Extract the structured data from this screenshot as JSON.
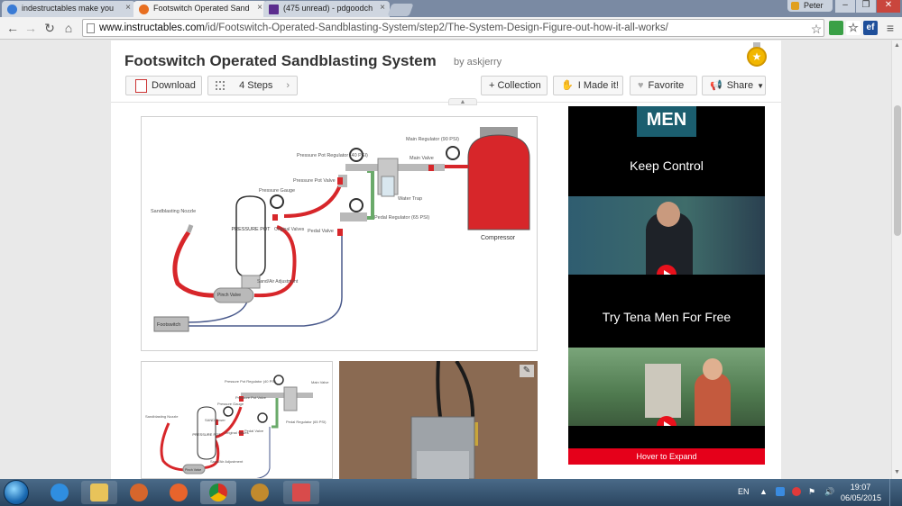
{
  "browser": {
    "tabs": [
      {
        "label": "indestructables make you",
        "icon_color": "#3a7bd5"
      },
      {
        "label": "Footswitch Operated Sand",
        "icon_color": "#e86f21"
      },
      {
        "label": "(475 unread) - pdgoodch",
        "icon_color": "#5b2d8e"
      }
    ],
    "user": "Peter",
    "window_controls": {
      "minimize": "–",
      "restore": "❐",
      "close": "✕"
    },
    "url": {
      "domain": "www.instructables.com",
      "path": "/id/Footswitch-Operated-Sandblasting-System/step2/The-System-Design-Figure-out-how-it-all-works/"
    },
    "nav": {
      "back": "←",
      "forward": "→",
      "reload": "↻",
      "home": "⌂",
      "star": "☆",
      "menu": "≡"
    },
    "extensions": [
      {
        "label": "",
        "color": "#3aa046"
      },
      {
        "label": "ef",
        "color": "#1f4f9a"
      }
    ]
  },
  "instructable": {
    "title": "Footswitch Operated Sandblasting System",
    "author": "by askjerry",
    "buttons": {
      "download": "Download",
      "steps": "4 Steps",
      "collection": "+ Collection",
      "made_it": "I Made it!",
      "favorite": "Favorite",
      "share": "Share"
    },
    "badge_icon": "★",
    "edit_icon": "✎"
  },
  "diagram": {
    "labels": {
      "main_regulator": "Main Regulator (90 PSI)",
      "pressure_pot_regulator": "Pressure Pot Regulator (40 PSI)",
      "main_valve": "Main Valve",
      "pressure_pot_valve": "Pressure Pot Valve",
      "pressure_gauge": "Pressure Gauge",
      "water_trap": "Water Trap",
      "sandblasting_nozzle": "Sandblasting Nozzle",
      "pressure_pot": "PRESSURE POT",
      "original_valves": "Original Valves",
      "pedal_regulator": "Pedal Regulator (65 PSI)",
      "pedal_valve": "Pedal Valve",
      "compressor": "Compressor",
      "sand_air_adjustment": "Sand/Air Adjustment",
      "pinch_valve": "Pinch Valve",
      "footswitch": "Footswitch"
    },
    "thumb_labels": {
      "pressure_pot_regulator": "Pressure Pot Regulator (40 PSI)",
      "main_valve": "Main Valve",
      "pressure_pot_valve": "Pressure Pot Valve",
      "pressure_gauge": "Pressure Gauge",
      "sandblasting_nozzle": "Sandblasting Nozzle",
      "sand_tower": "SAND Tower",
      "pressure_pot": "PRESSURE POT",
      "original_valves": "Original Valves",
      "pedal_regulator": "Pedal Regulator (65 PSI)",
      "pedal_valve": "Pedal Valve",
      "sand_air_adjustment": "Sand/Air Adjustment",
      "pinch_valve": "Pinch Valve"
    }
  },
  "ad": {
    "logo": "MEN",
    "headline1": "Keep Control",
    "headline2": "Try Tena Men For Free",
    "expand": "Hover to Expand"
  },
  "taskbar": {
    "apps": [
      {
        "name": "internet-explorer",
        "color": "#2f8ee0"
      },
      {
        "name": "file-explorer",
        "color": "#e8c35a"
      },
      {
        "name": "app-unknown",
        "color": "#d6662c"
      },
      {
        "name": "firefox",
        "color": "#e8642c"
      },
      {
        "name": "chrome",
        "color": "#4caf50"
      },
      {
        "name": "app-monkey",
        "color": "#c28a2d"
      },
      {
        "name": "app-window",
        "color": "#d84b4b"
      }
    ],
    "lang": "EN",
    "time": "19:07",
    "date": "06/05/2015"
  },
  "colors": {
    "accent_red": "#d7262a",
    "hose": "#d7262a",
    "air_line": "#4a5a8c",
    "ad_red": "#e5001a"
  }
}
